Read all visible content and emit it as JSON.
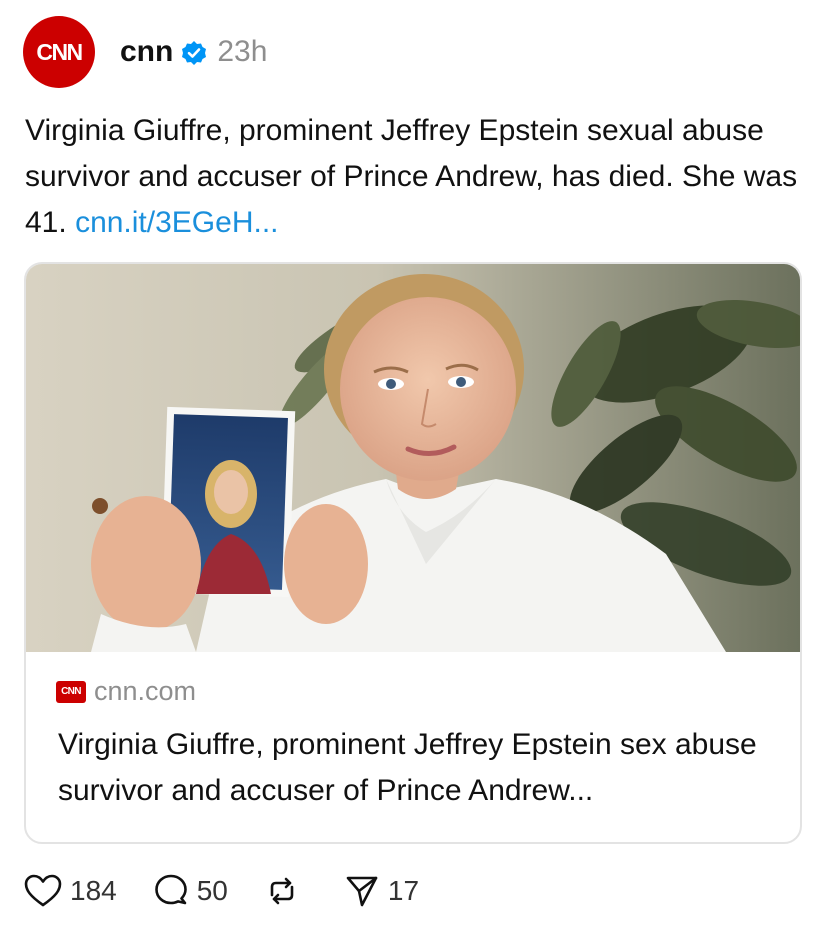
{
  "post": {
    "author": {
      "avatar_text": "CNN",
      "handle": "cnn",
      "verified": true,
      "timestamp": "23h"
    },
    "body": {
      "text": "Virginia Giuffre, prominent Jeffrey Epstein sexual abuse survivor and accuser of Prince Andrew, has died. She was 41.",
      "link": "cnn.it/3EGeH..."
    },
    "link_card": {
      "source_icon_text": "CNN",
      "domain": "cnn.com",
      "title": "Virginia Giuffre, prominent Jeffrey Epstein sex abuse survivor and accuser of Prince Andrew..."
    },
    "actions": {
      "likes": "184",
      "replies": "50",
      "reposts": "",
      "shares": "17"
    }
  },
  "colors": {
    "brand_red": "#cc0000",
    "link_blue": "#1a8fdc",
    "verified_blue": "#0095f6",
    "muted_gray": "#8e8e8e"
  },
  "icons": [
    "cnn-avatar",
    "verified-badge-icon",
    "heart-icon",
    "comment-icon",
    "repost-icon",
    "share-icon"
  ]
}
